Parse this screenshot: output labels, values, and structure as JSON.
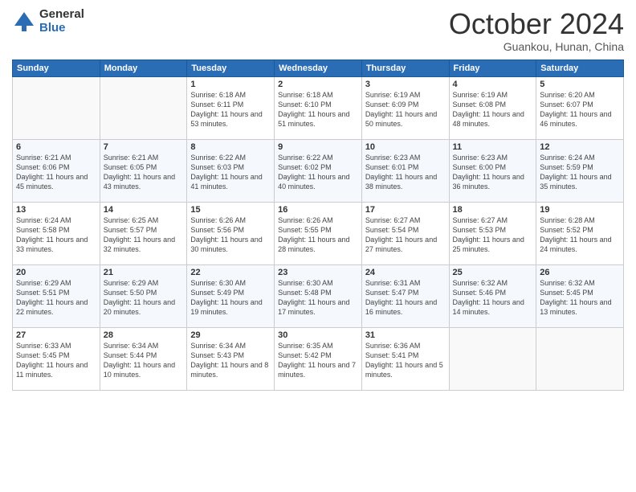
{
  "header": {
    "logo_general": "General",
    "logo_blue": "Blue",
    "month_title": "October 2024",
    "location": "Guankou, Hunan, China"
  },
  "days_of_week": [
    "Sunday",
    "Monday",
    "Tuesday",
    "Wednesday",
    "Thursday",
    "Friday",
    "Saturday"
  ],
  "weeks": [
    [
      {
        "day": "",
        "info": ""
      },
      {
        "day": "",
        "info": ""
      },
      {
        "day": "1",
        "info": "Sunrise: 6:18 AM\nSunset: 6:11 PM\nDaylight: 11 hours and 53 minutes."
      },
      {
        "day": "2",
        "info": "Sunrise: 6:18 AM\nSunset: 6:10 PM\nDaylight: 11 hours and 51 minutes."
      },
      {
        "day": "3",
        "info": "Sunrise: 6:19 AM\nSunset: 6:09 PM\nDaylight: 11 hours and 50 minutes."
      },
      {
        "day": "4",
        "info": "Sunrise: 6:19 AM\nSunset: 6:08 PM\nDaylight: 11 hours and 48 minutes."
      },
      {
        "day": "5",
        "info": "Sunrise: 6:20 AM\nSunset: 6:07 PM\nDaylight: 11 hours and 46 minutes."
      }
    ],
    [
      {
        "day": "6",
        "info": "Sunrise: 6:21 AM\nSunset: 6:06 PM\nDaylight: 11 hours and 45 minutes."
      },
      {
        "day": "7",
        "info": "Sunrise: 6:21 AM\nSunset: 6:05 PM\nDaylight: 11 hours and 43 minutes."
      },
      {
        "day": "8",
        "info": "Sunrise: 6:22 AM\nSunset: 6:03 PM\nDaylight: 11 hours and 41 minutes."
      },
      {
        "day": "9",
        "info": "Sunrise: 6:22 AM\nSunset: 6:02 PM\nDaylight: 11 hours and 40 minutes."
      },
      {
        "day": "10",
        "info": "Sunrise: 6:23 AM\nSunset: 6:01 PM\nDaylight: 11 hours and 38 minutes."
      },
      {
        "day": "11",
        "info": "Sunrise: 6:23 AM\nSunset: 6:00 PM\nDaylight: 11 hours and 36 minutes."
      },
      {
        "day": "12",
        "info": "Sunrise: 6:24 AM\nSunset: 5:59 PM\nDaylight: 11 hours and 35 minutes."
      }
    ],
    [
      {
        "day": "13",
        "info": "Sunrise: 6:24 AM\nSunset: 5:58 PM\nDaylight: 11 hours and 33 minutes."
      },
      {
        "day": "14",
        "info": "Sunrise: 6:25 AM\nSunset: 5:57 PM\nDaylight: 11 hours and 32 minutes."
      },
      {
        "day": "15",
        "info": "Sunrise: 6:26 AM\nSunset: 5:56 PM\nDaylight: 11 hours and 30 minutes."
      },
      {
        "day": "16",
        "info": "Sunrise: 6:26 AM\nSunset: 5:55 PM\nDaylight: 11 hours and 28 minutes."
      },
      {
        "day": "17",
        "info": "Sunrise: 6:27 AM\nSunset: 5:54 PM\nDaylight: 11 hours and 27 minutes."
      },
      {
        "day": "18",
        "info": "Sunrise: 6:27 AM\nSunset: 5:53 PM\nDaylight: 11 hours and 25 minutes."
      },
      {
        "day": "19",
        "info": "Sunrise: 6:28 AM\nSunset: 5:52 PM\nDaylight: 11 hours and 24 minutes."
      }
    ],
    [
      {
        "day": "20",
        "info": "Sunrise: 6:29 AM\nSunset: 5:51 PM\nDaylight: 11 hours and 22 minutes."
      },
      {
        "day": "21",
        "info": "Sunrise: 6:29 AM\nSunset: 5:50 PM\nDaylight: 11 hours and 20 minutes."
      },
      {
        "day": "22",
        "info": "Sunrise: 6:30 AM\nSunset: 5:49 PM\nDaylight: 11 hours and 19 minutes."
      },
      {
        "day": "23",
        "info": "Sunrise: 6:30 AM\nSunset: 5:48 PM\nDaylight: 11 hours and 17 minutes."
      },
      {
        "day": "24",
        "info": "Sunrise: 6:31 AM\nSunset: 5:47 PM\nDaylight: 11 hours and 16 minutes."
      },
      {
        "day": "25",
        "info": "Sunrise: 6:32 AM\nSunset: 5:46 PM\nDaylight: 11 hours and 14 minutes."
      },
      {
        "day": "26",
        "info": "Sunrise: 6:32 AM\nSunset: 5:45 PM\nDaylight: 11 hours and 13 minutes."
      }
    ],
    [
      {
        "day": "27",
        "info": "Sunrise: 6:33 AM\nSunset: 5:45 PM\nDaylight: 11 hours and 11 minutes."
      },
      {
        "day": "28",
        "info": "Sunrise: 6:34 AM\nSunset: 5:44 PM\nDaylight: 11 hours and 10 minutes."
      },
      {
        "day": "29",
        "info": "Sunrise: 6:34 AM\nSunset: 5:43 PM\nDaylight: 11 hours and 8 minutes."
      },
      {
        "day": "30",
        "info": "Sunrise: 6:35 AM\nSunset: 5:42 PM\nDaylight: 11 hours and 7 minutes."
      },
      {
        "day": "31",
        "info": "Sunrise: 6:36 AM\nSunset: 5:41 PM\nDaylight: 11 hours and 5 minutes."
      },
      {
        "day": "",
        "info": ""
      },
      {
        "day": "",
        "info": ""
      }
    ]
  ]
}
